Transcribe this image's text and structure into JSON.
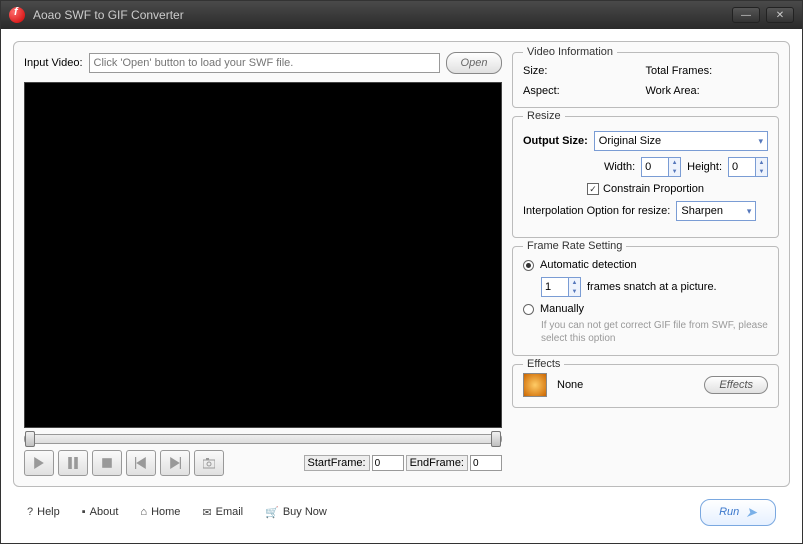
{
  "window": {
    "title": "Aoao SWF to GIF Converter"
  },
  "input": {
    "label": "Input Video:",
    "placeholder": "Click 'Open' button to load your SWF file.",
    "open_btn": "Open"
  },
  "seek": {
    "start_frame_label": "StartFrame:",
    "start_frame_value": "0",
    "end_frame_label": "EndFrame:",
    "end_frame_value": "0"
  },
  "video_info": {
    "legend": "Video Information",
    "size_label": "Size:",
    "total_frames_label": "Total Frames:",
    "aspect_label": "Aspect:",
    "work_area_label": "Work Area:"
  },
  "resize": {
    "legend": "Resize",
    "output_size_label": "Output Size:",
    "output_size_value": "Original Size",
    "width_label": "Width:",
    "width_value": "0",
    "height_label": "Height:",
    "height_value": "0",
    "constrain_label": "Constrain Proportion",
    "interp_label": "Interpolation Option for resize:",
    "interp_value": "Sharpen"
  },
  "frame_rate": {
    "legend": "Frame Rate Setting",
    "auto_label": "Automatic detection",
    "snatch_value": "1",
    "snatch_suffix": "frames snatch at a picture.",
    "manual_label": "Manually",
    "manual_hint": "If you can not get correct GIF file from SWF, please select this option"
  },
  "effects": {
    "legend": "Effects",
    "current": "None",
    "button": "Effects"
  },
  "footer": {
    "help": "Help",
    "about": "About",
    "home": "Home",
    "email": "Email",
    "buy": "Buy Now",
    "run": "Run"
  }
}
